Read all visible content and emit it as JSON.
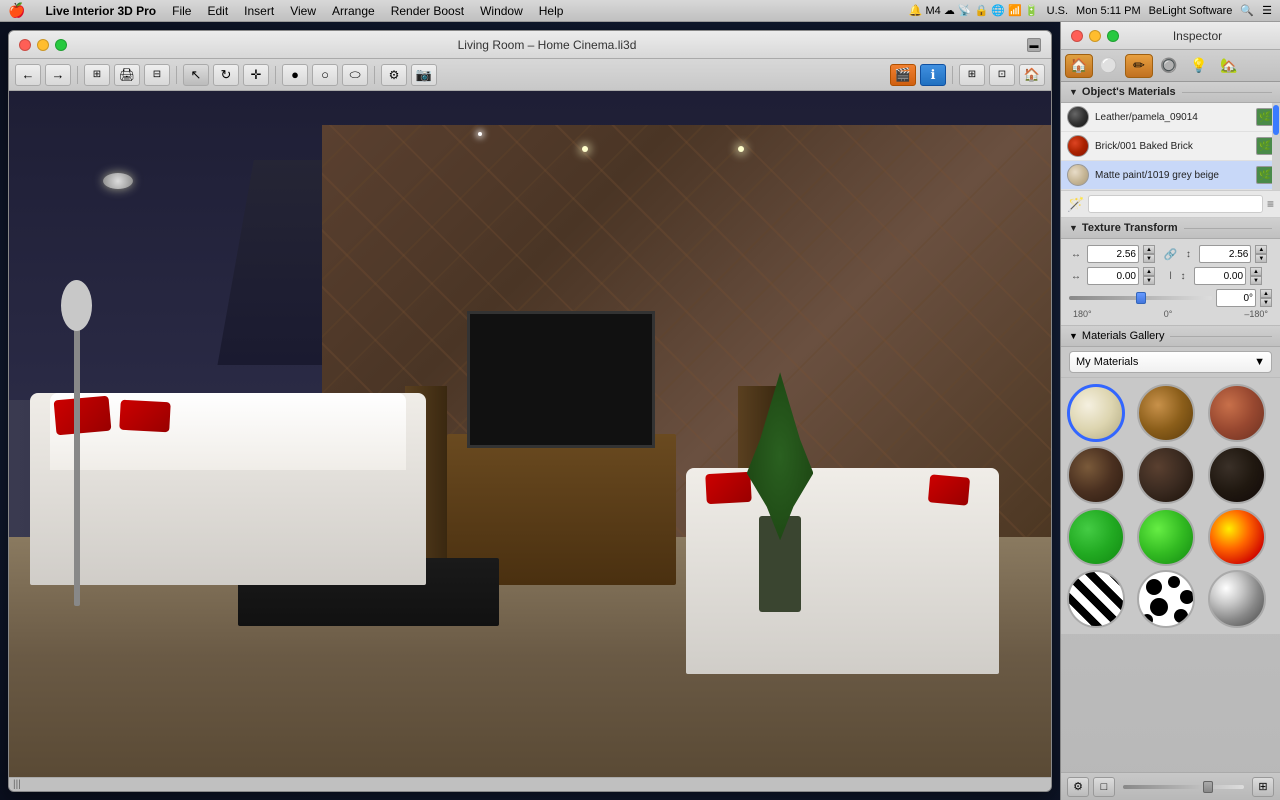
{
  "menubar": {
    "apple": "🍎",
    "app_name": "Live Interior 3D Pro",
    "menus": [
      "File",
      "Edit",
      "Insert",
      "View",
      "Arrange",
      "Render Boost",
      "Window",
      "Help"
    ],
    "right_info": "U.S. Mon 5:11 PM BeLight Software"
  },
  "viewport": {
    "title": "Living Room – Home Cinema.li3d",
    "toolbar_buttons": [
      "←",
      "→",
      "🏠",
      "▢",
      "📋",
      "⊕",
      "✎",
      "📷"
    ],
    "scrollbar_label": "|||"
  },
  "inspector": {
    "title": "Inspector",
    "tabs": [
      "🏠",
      "⚪",
      "✏",
      "🔘",
      "💡",
      "🏡"
    ],
    "objects_materials_label": "Object's Materials",
    "materials": [
      {
        "name": "Leather/pamela_09014",
        "swatch": "dark-gray"
      },
      {
        "name": "Brick/001 Baked Brick",
        "swatch": "red"
      },
      {
        "name": "Matte paint/1019 grey beige",
        "swatch": "beige"
      }
    ],
    "texture_transform": {
      "label": "Texture Transform",
      "scale_x": "2.56",
      "scale_y": "2.56",
      "offset_x": "0.00",
      "offset_y": "0.00",
      "angle": "0°",
      "tick_left": "180°",
      "tick_center": "0°",
      "tick_right": "–180°"
    },
    "gallery": {
      "label": "Materials Gallery",
      "dropdown_value": "My Materials",
      "spheres": [
        {
          "id": "beige",
          "style": "sphere-beige",
          "selected": true
        },
        {
          "id": "wood",
          "style": "sphere-wood",
          "selected": false
        },
        {
          "id": "brick-gallery",
          "style": "sphere-brick-gallery",
          "selected": false
        },
        {
          "id": "dark-metal",
          "style": "sphere-dark-wood",
          "selected": false
        },
        {
          "id": "brown-dark",
          "style": "sphere-brown-dark",
          "selected": false
        },
        {
          "id": "very-dark",
          "style": "sphere-very-dark",
          "selected": false
        },
        {
          "id": "green",
          "style": "sphere-green",
          "selected": false
        },
        {
          "id": "bright-green",
          "style": "sphere-bright-green",
          "selected": false
        },
        {
          "id": "fire",
          "style": "sphere-fire",
          "selected": false
        },
        {
          "id": "zebra",
          "style": "sphere-zebra",
          "selected": false
        },
        {
          "id": "spots",
          "style": "sphere-spots",
          "selected": false
        },
        {
          "id": "chrome",
          "style": "sphere-chrome",
          "selected": false
        }
      ]
    },
    "bottom_buttons": [
      "⚙",
      "□",
      "📷"
    ]
  }
}
